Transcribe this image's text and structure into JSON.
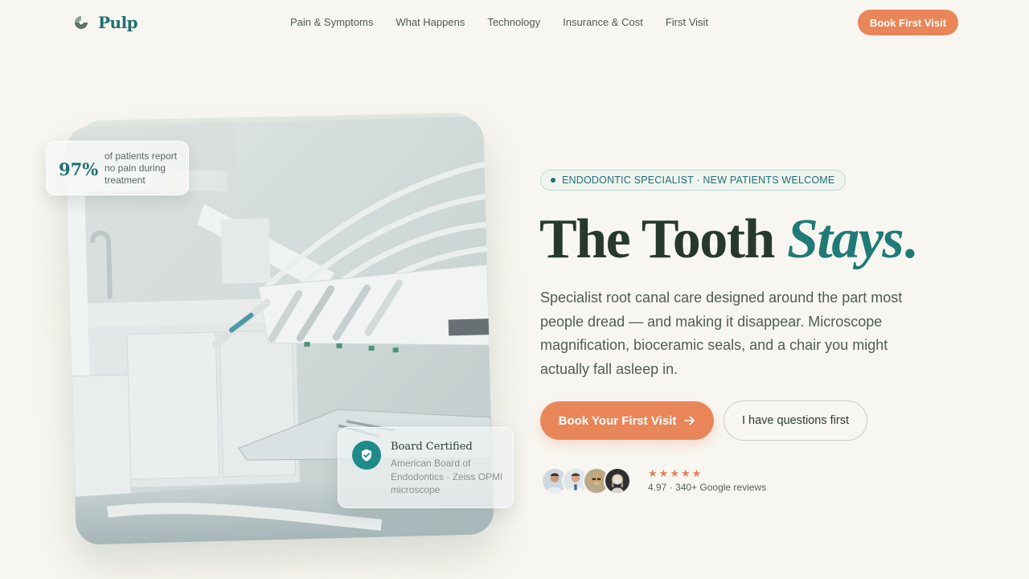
{
  "brand": {
    "name": "Pulp",
    "icon": "tooth-logo-icon"
  },
  "nav": {
    "links": [
      "Pain & Symptoms",
      "What Happens",
      "Technology",
      "Insurance & Cost",
      "First Visit"
    ],
    "cta": "Book First Visit"
  },
  "stat": {
    "value": "97%",
    "text": "of patients report no pain during treatment"
  },
  "certification": {
    "title": "Board Certified",
    "subtitle": "American Board of Endodontics · Zeiss OPMI microscope",
    "icon": "shield-check-icon"
  },
  "hero": {
    "eyebrow": "ENDODONTIC SPECIALIST · NEW PATIENTS WELCOME",
    "title_main": "The Tooth ",
    "title_accent": "Stays",
    "title_period": ".",
    "body": "Specialist root canal care designed around the part most people dread — and making it disappear. Microscope magnification, bioceramic seals, and a chair you might actually fall asleep in.",
    "primary_cta": "Book Your First Visit",
    "primary_cta_icon": "arrow-right-icon",
    "secondary_cta": "I have questions first"
  },
  "reviews": {
    "stars": 5,
    "summary": "4.97 · 340+ Google reviews",
    "avatar_count": 4
  },
  "colors": {
    "background": "#f8f6f0",
    "brand_teal": "#1f6f73",
    "accent_orange": "#e8865a",
    "heading": "#27392f"
  }
}
